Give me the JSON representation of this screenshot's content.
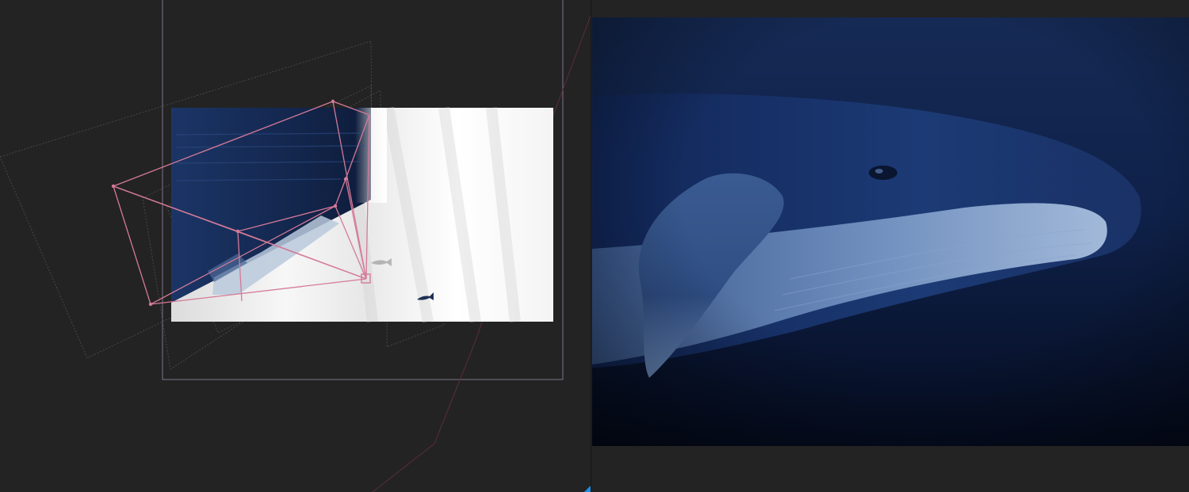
{
  "app": {
    "layout": "split-view",
    "left_panel": "3d-scene-perspective",
    "right_panel": "render-preview"
  },
  "colors": {
    "background": "#232323",
    "rig_lines": "#d57a98",
    "guide_lines": "#5f5f6a",
    "camera_frame": "#77707f",
    "accent_corner": "#1e90e8",
    "ocean_deep": "#0b1835",
    "whale_body": "#1c3a72",
    "whale_belly": "#7f9ec7"
  },
  "icons": {
    "corner_marker": "triangle-corner-icon",
    "fish_1": "fish-icon",
    "fish_2": "fish-icon"
  }
}
